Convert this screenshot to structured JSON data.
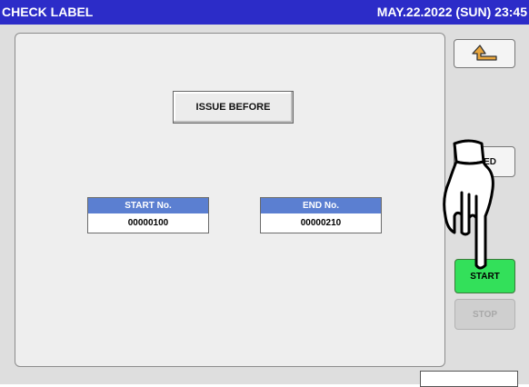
{
  "titlebar": {
    "title": "CHECK LABEL",
    "datetime": "MAY.22.2022 (SUN)  23:45"
  },
  "main": {
    "issue_button": "ISSUE BEFORE",
    "start_no": {
      "label": "START No.",
      "value": "00000100"
    },
    "end_no": {
      "label": "END No.",
      "value": "00000210"
    }
  },
  "side": {
    "back_icon": "return-arrow-icon",
    "partially_hidden_button": "ED",
    "start_button": "START",
    "stop_button": "STOP"
  },
  "overlay": {
    "pointer_icon": "hand-pointer-icon"
  },
  "colors": {
    "titlebar": "#2c2cc8",
    "header_blue": "#5b7fd1",
    "start_green": "#33e05a",
    "arrow_orange": "#e8a53c"
  }
}
